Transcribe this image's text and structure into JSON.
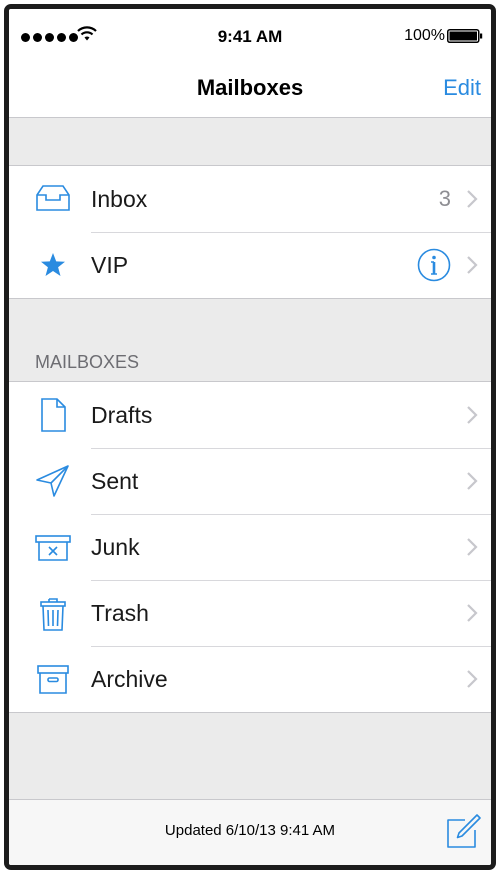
{
  "status_bar": {
    "time": "9:41 AM",
    "battery": "100%"
  },
  "nav": {
    "title": "Mailboxes",
    "edit_label": "Edit"
  },
  "top_group": [
    {
      "label": "Inbox",
      "icon": "inbox-tray-icon",
      "count": "3"
    },
    {
      "label": "VIP",
      "icon": "star-icon",
      "accessory": "info-icon"
    }
  ],
  "section_header": "MAILBOXES",
  "mailboxes": [
    {
      "label": "Drafts",
      "icon": "document-icon"
    },
    {
      "label": "Sent",
      "icon": "paper-plane-icon"
    },
    {
      "label": "Junk",
      "icon": "junk-bin-icon"
    },
    {
      "label": "Trash",
      "icon": "trash-can-icon"
    },
    {
      "label": "Archive",
      "icon": "archive-box-icon"
    }
  ],
  "toolbar": {
    "status": "Updated 6/10/13 9:41 AM",
    "compose_icon": "compose-icon"
  },
  "colors": {
    "accent": "#2a8be0",
    "background": "#ebebeb",
    "separator": "#c8c8cc",
    "secondary_text": "#8e8e93"
  }
}
